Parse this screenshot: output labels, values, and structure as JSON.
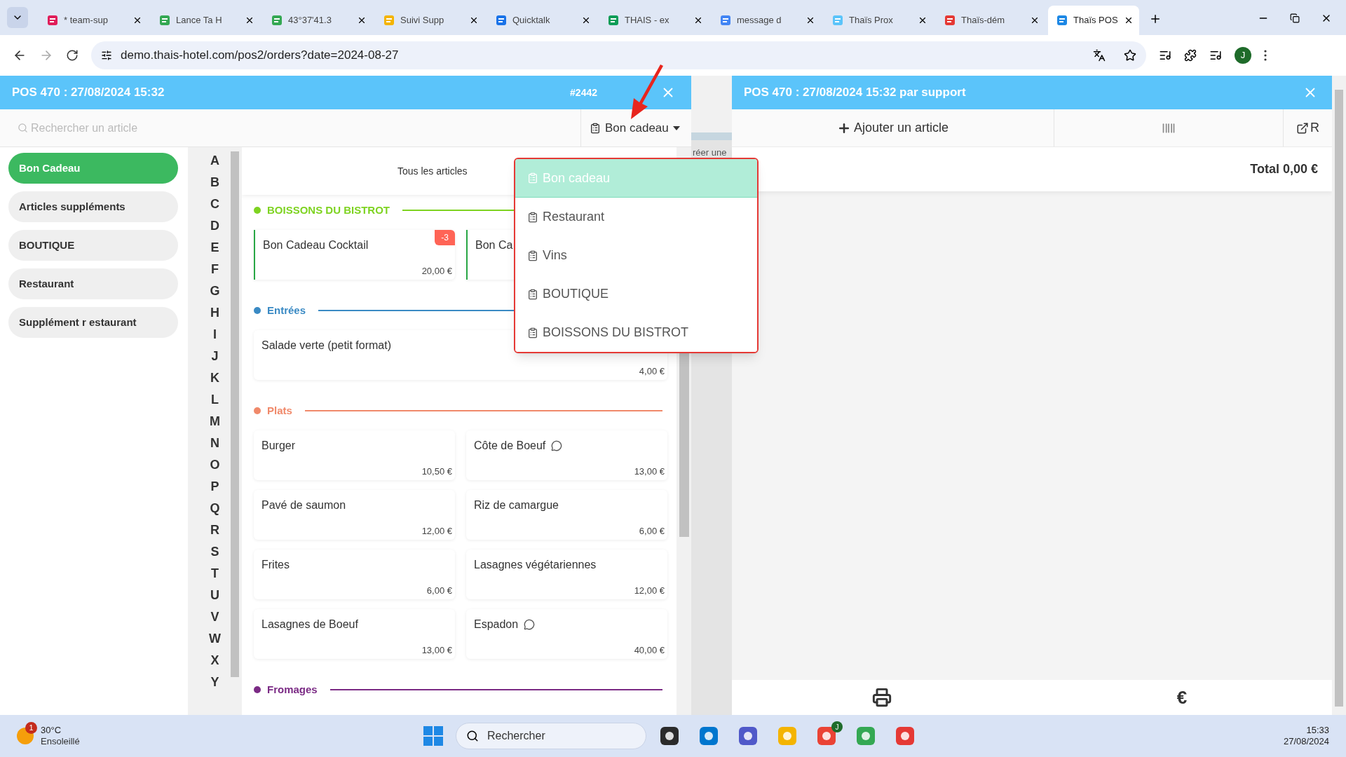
{
  "browser": {
    "tabs": [
      {
        "title": "* team-sup",
        "color": "#e01e5a",
        "selected": false
      },
      {
        "title": "Lance Ta H",
        "color": "#34a853",
        "selected": false
      },
      {
        "title": "43°37'41.3",
        "color": "#34a853",
        "selected": false
      },
      {
        "title": "Suivi Supp",
        "color": "#f4b400",
        "selected": false
      },
      {
        "title": "Quicktalk",
        "color": "#1a73e8",
        "selected": false
      },
      {
        "title": "THAIS - ex",
        "color": "#0f9d58",
        "selected": false
      },
      {
        "title": "message d",
        "color": "#4285f4",
        "selected": false
      },
      {
        "title": "Thaïs Prox",
        "color": "#5bc4fa",
        "selected": false
      },
      {
        "title": "Thaïs-dém",
        "color": "#e53935",
        "selected": false
      },
      {
        "title": "Thaïs POS",
        "color": "#1e88e5",
        "selected": true
      }
    ],
    "address": "demo.thais-hotel.com/pos2/orders?date=2024-08-27",
    "profile": "J"
  },
  "left_panel": {
    "title": "POS 470 : 27/08/2024 15:32",
    "order_number": "#2442",
    "search": {
      "placeholder": "Rechercher un article"
    },
    "category_select": "Bon cadeau",
    "categories": [
      {
        "label": "Bon Cadeau",
        "selected": true
      },
      {
        "label": "Articles suppléments",
        "selected": false
      },
      {
        "label": "BOUTIQUE",
        "selected": false
      },
      {
        "label": "Restaurant",
        "selected": false
      },
      {
        "label": "Supplément r estaurant",
        "selected": false
      }
    ],
    "letters": [
      "A",
      "B",
      "C",
      "D",
      "E",
      "F",
      "G",
      "H",
      "I",
      "J",
      "K",
      "L",
      "M",
      "N",
      "O",
      "P",
      "Q",
      "R",
      "S",
      "T",
      "U",
      "V",
      "W",
      "X",
      "Y"
    ],
    "view_tab": "Tous les articles",
    "sections": [
      {
        "title": "BOISSONS DU BISTROT",
        "color": "#7ed321",
        "items": [
          {
            "name": "Bon Cadeau Cocktail",
            "price": "20,00 €",
            "badge": "-3",
            "comment": false,
            "accent": true
          },
          {
            "name": "Bon Ca",
            "comment": false,
            "accent": true
          }
        ]
      },
      {
        "title": "Entrées",
        "color": "#3a8ac4",
        "items": [
          {
            "name": "Salade verte (petit format)",
            "price": "4,00 €",
            "comment": false,
            "accent": false,
            "kind": "wide"
          }
        ]
      },
      {
        "title": "Plats",
        "color": "#f0896a",
        "items": [
          {
            "name": "Burger",
            "price": "10,50 €",
            "comment": false,
            "accent": false
          },
          {
            "name": "Côte de Boeuf",
            "price": "13,00 €",
            "comment": true,
            "accent": false
          },
          {
            "name": "Pavé de saumon",
            "price": "12,00 €",
            "comment": false,
            "accent": false
          },
          {
            "name": "Riz de camargue",
            "price": "6,00 €",
            "comment": false,
            "accent": false
          },
          {
            "name": "Frites",
            "price": "6,00 €",
            "comment": false,
            "accent": false
          },
          {
            "name": "Lasagnes végétariennes",
            "price": "12,00 €",
            "comment": false,
            "accent": false
          },
          {
            "name": "Lasagnes de Boeuf",
            "price": "13,00 €",
            "comment": false,
            "accent": false
          },
          {
            "name": "Espadon",
            "price": "40,00 €",
            "comment": true,
            "accent": false
          }
        ]
      },
      {
        "title": "Fromages",
        "color": "#7b2b85"
      }
    ]
  },
  "dropdown": {
    "items": [
      {
        "label": "Bon cadeau",
        "selected": true
      },
      {
        "label": "Restaurant",
        "selected": false
      },
      {
        "label": "Vins",
        "selected": false
      },
      {
        "label": "BOUTIQUE",
        "selected": false
      },
      {
        "label": "BOISSONS DU BISTROT",
        "selected": false
      }
    ]
  },
  "backdrop_text": "réer une",
  "right_panel": {
    "title": "POS 470 : 27/08/2024 15:32 par support",
    "add_button": "Ajouter un article",
    "export_label": "R",
    "total": "Total 0,00 €",
    "pay_symbol": "€"
  },
  "taskbar": {
    "weather_badge": "1",
    "temperature": "30°C",
    "condition": "Ensoleillé",
    "search": "Rechercher",
    "app_avatar": "J",
    "time": "15:33",
    "date": "27/08/2024"
  }
}
